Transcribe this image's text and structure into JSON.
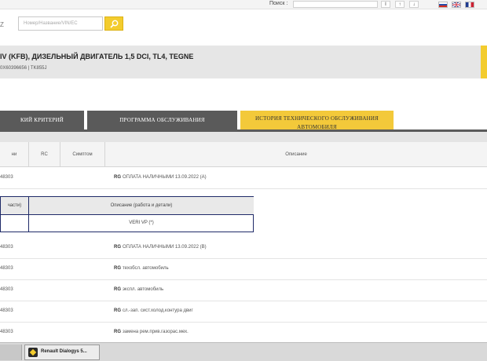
{
  "topbar": {
    "search_label": "Поиск :",
    "buttons": [
      "I",
      "↑",
      "↓"
    ],
    "flags": [
      {
        "name": "ru-flag",
        "colors": [
          "#ffffff",
          "#2b4fa8",
          "#d52b1e"
        ]
      },
      {
        "name": "uk-flag",
        "colors": [
          "#1f3b8f",
          "#ffffff",
          "#cc2233"
        ]
      },
      {
        "name": "fr-flag",
        "colors": [
          "#1f3b8f",
          "#ffffff",
          "#cc2233"
        ]
      }
    ]
  },
  "search": {
    "label": "Z",
    "placeholder": "Номер/Название/VIN/ЕС"
  },
  "vehicle": {
    "title": "IV (KFB), ДИЗЕЛЬНЫЙ ДВИГАТЕЛЬ 1,5 DCI, TL4, TEGNE",
    "subtitle": "0X60396656 | TK855J"
  },
  "tabs": [
    {
      "label": "КИЙ КРИТЕРИЙ",
      "active": false
    },
    {
      "label": "ПРОГРАММА ОБСЛУЖИВАНИЯ",
      "active": false
    },
    {
      "label": "ИСТОРИЯ ТЕХНИЧЕСКОГО ОБСЛУЖИВАНИЯ АВТОМОБИЛЯ",
      "active": true
    }
  ],
  "table": {
    "headers": [
      "ни",
      "RC",
      "Симптом",
      "Описание"
    ],
    "rows": [
      {
        "num": "48303",
        "code": "RG",
        "text": "ОПЛАТА НАЛИЧНЫМИ 13.09.2022 (A)"
      },
      {
        "num": "48303",
        "code": "RG",
        "text": "ОПЛАТА НАЛИЧНЫМИ 13.09.2022 (B)"
      },
      {
        "num": "48303",
        "code": "RG",
        "text": "техобсл. автомобиль"
      },
      {
        "num": "48303",
        "code": "RG",
        "text": "экспл. автомобиль"
      },
      {
        "num": "48303",
        "code": "RG",
        "text": "сл.-зап. сист.холод.контура двиг"
      },
      {
        "num": "48303",
        "code": "RG",
        "text": "замена рем.прив.газорас.мех."
      }
    ],
    "subtable": {
      "headers": [
        "части)",
        "Описание (работа и детали)"
      ],
      "value": "VERI VP (*)"
    }
  },
  "taskbar": {
    "app_label": "Renault Dialogys 5...",
    "app_icon": "renault-logo-icon"
  },
  "colors": {
    "accent": "#f3cc2e",
    "tab_dark": "#5a5a5a",
    "subtable_border": "#1f2a68"
  }
}
